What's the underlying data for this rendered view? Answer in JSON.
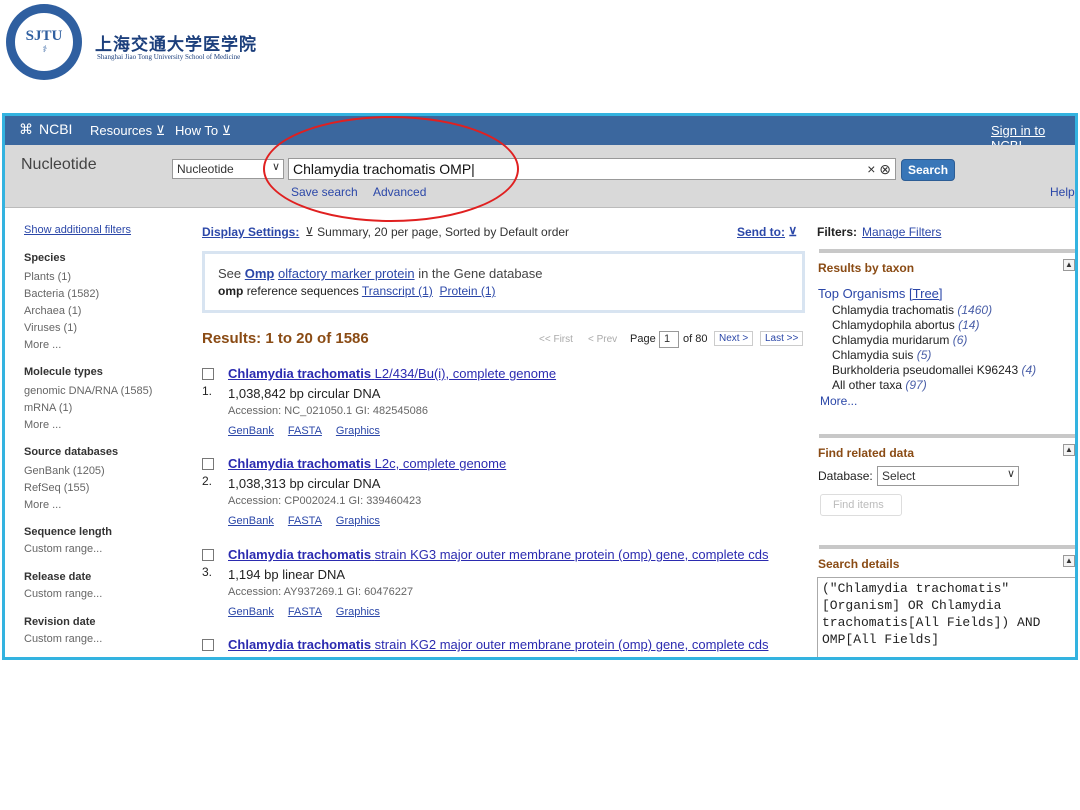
{
  "header": {
    "school_cn": "上海交通大学医学院",
    "school_en": "Shanghai Jiao Tong University School of Medicine",
    "seal_monogram": "SJTU"
  },
  "topbar": {
    "logo": "NCBI",
    "resources": "Resources",
    "howto": "How To",
    "signin": "Sign in to NCBI"
  },
  "dbbar": {
    "db_title": "Nucleotide",
    "db_select": "Nucleotide",
    "query": "Chlamydia trachomatis OMP",
    "search_btn": "Search",
    "save_search": "Save search",
    "advanced": "Advanced",
    "help": "Help"
  },
  "left": {
    "show_filters": "Show additional filters",
    "species_hd": "Species",
    "species": [
      "Plants (1)",
      "Bacteria (1582)",
      "Archaea (1)",
      "Viruses (1)",
      "More ..."
    ],
    "mol_hd": "Molecule types",
    "mol": [
      "genomic DNA/RNA (1585)",
      "mRNA (1)",
      "More ..."
    ],
    "src_hd": "Source databases",
    "src": [
      "GenBank (1205)",
      "RefSeq (155)",
      "More ..."
    ],
    "seqlen_hd": "Sequence length",
    "seqlen": "Custom range...",
    "release_hd": "Release date",
    "release": "Custom range...",
    "revision_hd": "Revision date",
    "revision": "Custom range..."
  },
  "main": {
    "display_settings": "Display Settings:",
    "display_desc": "Summary, 20 per page, Sorted by Default order",
    "send_to": "Send to:",
    "gene_see": "See",
    "gene_omp": "Omp",
    "gene_link": "olfactory marker protein",
    "gene_rest": "in the Gene database",
    "ref_omp": "omp",
    "ref_text": "reference sequences",
    "ref_transcript": "Transcript (1)",
    "ref_protein": "Protein (1)",
    "results_label": "Results: 1 to 20 of 1586",
    "pager": {
      "first": "<< First",
      "prev": "< Prev",
      "page": "Page",
      "page_val": "1",
      "of": "of 80",
      "next": "Next >",
      "last": "Last >>"
    },
    "results": [
      {
        "num": "1.",
        "title_bold": "Chlamydia trachomatis",
        "title_rest": "L2/434/Bu(i), complete genome",
        "line": "1,038,842 bp circular DNA",
        "acc": "Accession: NC_021050.1   GI: 482545086"
      },
      {
        "num": "2.",
        "title_bold": "Chlamydia trachomatis",
        "title_rest": "L2c, complete genome",
        "line": "1,038,313 bp circular DNA",
        "acc": "Accession: CP002024.1   GI: 339460423"
      },
      {
        "num": "3.",
        "title_bold": "Chlamydia trachomatis",
        "title_rest": "strain KG3 major outer membrane protein (omp) gene, complete cds",
        "line": "1,194 bp linear DNA",
        "acc": "Accession: AY937269.1   GI: 60476227"
      },
      {
        "num": "",
        "title_bold": "Chlamydia trachomatis",
        "title_rest": "strain KG2 major outer membrane protein (omp) gene, complete cds",
        "line": "",
        "acc": ""
      }
    ],
    "links": [
      "GenBank",
      "FASTA",
      "Graphics"
    ]
  },
  "right": {
    "filters_label": "Filters:",
    "manage_filters": "Manage Filters",
    "taxon_hd": "Results by taxon",
    "top_orgs": "Top Organisms",
    "tree": "[Tree]",
    "orgs": [
      {
        "name": "Chlamydia trachomatis",
        "count": "(1460)"
      },
      {
        "name": "Chlamydophila abortus",
        "count": "(14)"
      },
      {
        "name": "Chlamydia muridarum",
        "count": "(6)"
      },
      {
        "name": "Chlamydia suis",
        "count": "(5)"
      },
      {
        "name": "Burkholderia pseudomallei K96243",
        "count": "(4)"
      },
      {
        "name": "All other taxa",
        "count": "(97)"
      }
    ],
    "more": "More...",
    "related_hd": "Find related data",
    "database_label": "Database:",
    "database_val": "Select",
    "find_items": "Find items",
    "details_hd": "Search details",
    "details_text": "(\"Chlamydia trachomatis\"[Organism] OR Chlamydia trachomatis[All Fields]) AND OMP[All Fields]"
  }
}
